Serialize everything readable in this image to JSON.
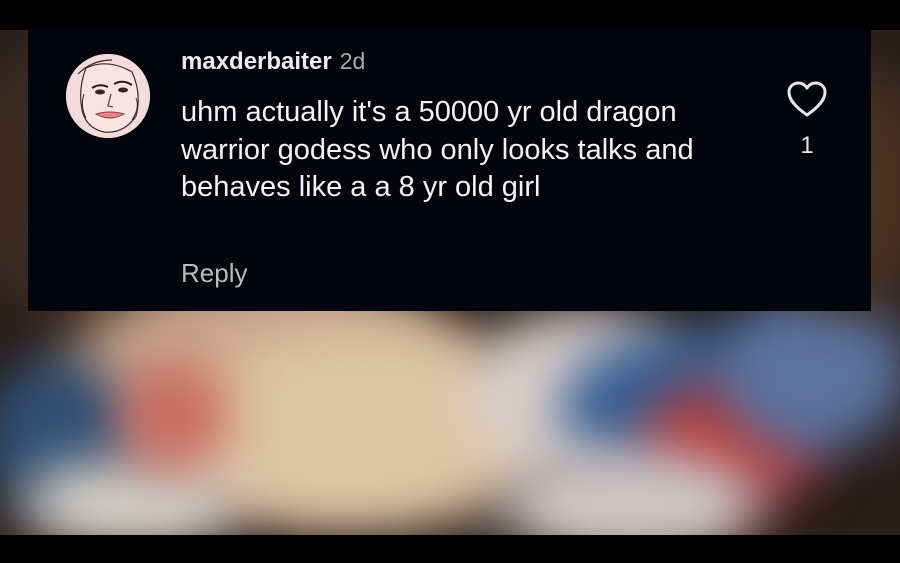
{
  "comment": {
    "username": "maxderbaiter",
    "time_ago": "2d",
    "text": "uhm actually it's a 50000 yr old dragon warrior godess who only looks talks and behaves like a a 8 yr old girl",
    "reply_label": "Reply",
    "like_count": "1",
    "like_icon": "heart-outline-icon",
    "avatar_icon": "avatar-face-drawing"
  },
  "colors": {
    "card_background": "#03040c",
    "username": "#ececef",
    "meta_text": "#a9abb3",
    "body_text": "#f4f4f6"
  }
}
